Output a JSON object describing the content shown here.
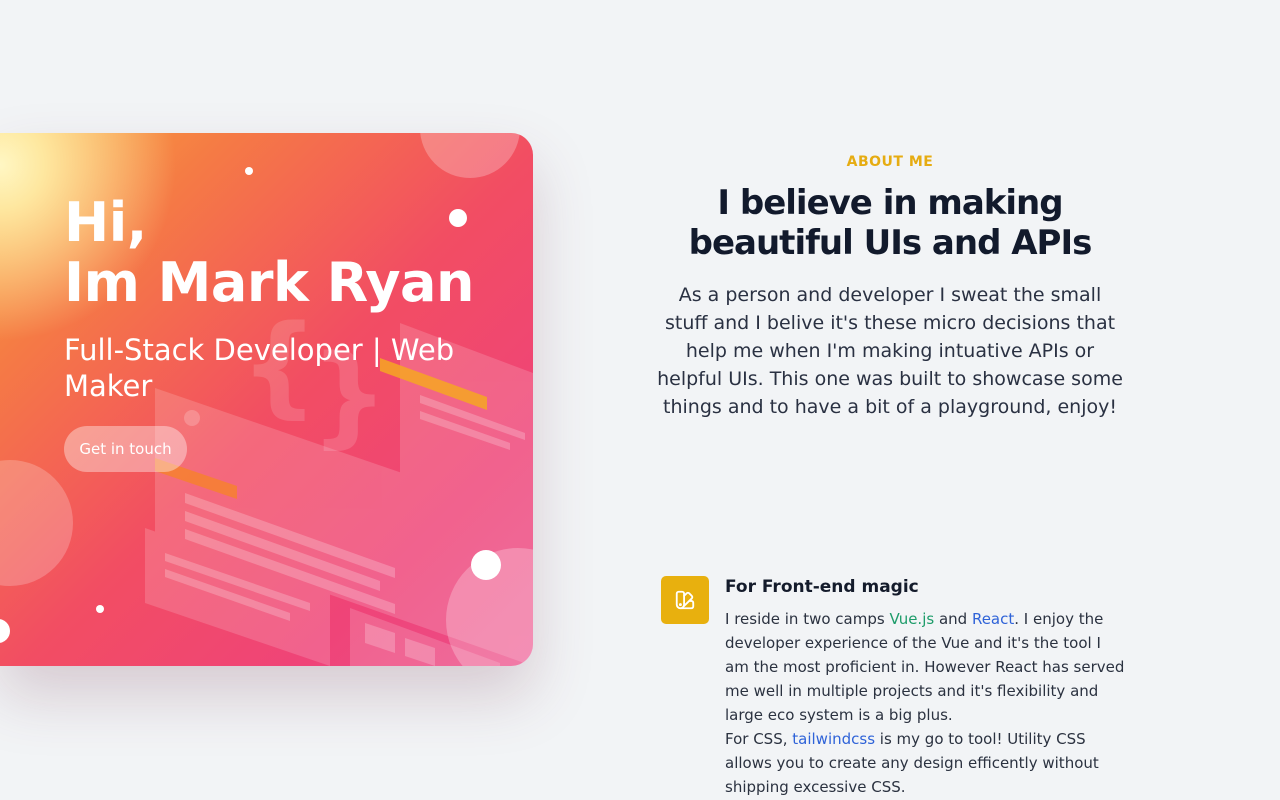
{
  "hero": {
    "greeting": "Hi,",
    "name": "Im Mark Ryan",
    "subtitle": "Full-Stack Developer | Web Maker",
    "cta_label": "Get in touch"
  },
  "about": {
    "eyebrow": "ABOUT ME",
    "title_line1": "I believe in making",
    "title_line2": "beautiful UIs and APIs",
    "body": "As a person and developer I sweat the small stuff and I belive it's these micro decisions that help me when I'm making intuative APIs or helpful UIs. This one was built to showcase some things and to have a bit of a playground, enjoy!"
  },
  "feature": {
    "icon": "swatch-icon",
    "title": "For Front-end magic",
    "p1_a": "I reside in two camps ",
    "link_vue": "Vue.js",
    "p1_b": " and ",
    "link_react": "React",
    "p1_c": ". I enjoy the developer experience of the Vue and it's the tool I am the most proficient in. However React has served me well in multiple projects and it's flexibility and large eco system is a big plus.",
    "p2_a": "For CSS, ",
    "link_tailwind": "tailwindcss",
    "p2_b": " is my go to tool! Utility CSS allows you to create any design efficently without shipping excessive CSS."
  },
  "colors": {
    "accent": "#e8b00e",
    "background": "#f2f4f6",
    "link_green": "#1e9c6a",
    "link_blue": "#2f63d8"
  }
}
